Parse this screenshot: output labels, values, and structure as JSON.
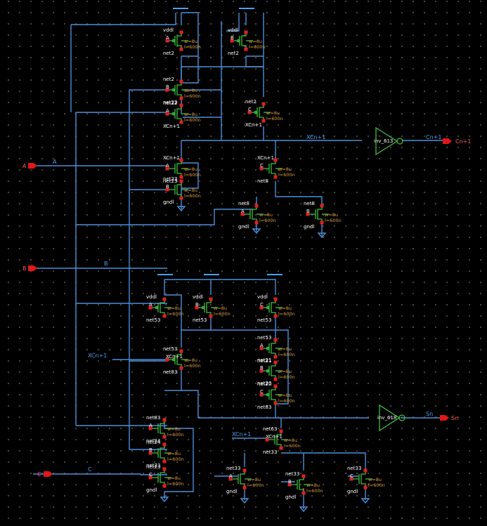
{
  "pins": {
    "A": "A",
    "B": "B",
    "C": "C",
    "Cn1": "Cn+1",
    "Sn": "Sn"
  },
  "nets": {
    "A": "A",
    "B": "B",
    "C": "C",
    "xcn1_top": "XCn+1",
    "xcn1_mid": "XCn+1",
    "xcn1_bot": "XCn+1",
    "cn1": "Cn+1",
    "sn": "Sn"
  },
  "inverters": {
    "carry": "inv_613",
    "sum": "inv_618"
  },
  "transistors": [
    {
      "id": "p1",
      "s": "vddl",
      "g": "A",
      "d": "net2",
      "w": "w=8u",
      "l": "l=600n"
    },
    {
      "id": "p2",
      "s": "vddl",
      "g": "B",
      "d": "net2",
      "w": "w=8u",
      "l": "l=600n"
    },
    {
      "id": "p3",
      "s": "net2",
      "g": "B",
      "d": "net22",
      "w": "w=8u",
      "l": "l=600n"
    },
    {
      "id": "p4",
      "s": "net22",
      "g": "A",
      "d": "XCn+1",
      "w": "w=8u",
      "l": "l=600n"
    },
    {
      "id": "p5",
      "s": "net2",
      "g": "C",
      "d": "XCn+1",
      "w": "w=8u",
      "l": "l=600n"
    },
    {
      "id": "n1",
      "s": "XCn+1",
      "g": "A",
      "d": "net23",
      "w": "w=8u",
      "l": "l=600n"
    },
    {
      "id": "n2",
      "s": "net23",
      "g": "B",
      "d": "gndl",
      "w": "w=8u",
      "l": "l=600n"
    },
    {
      "id": "n3",
      "s": "XCn+1",
      "g": "C",
      "d": "net8",
      "w": "w=8u",
      "l": "l=600n"
    },
    {
      "id": "n4",
      "s": "net8",
      "g": "A",
      "d": "gndl",
      "w": "w=8u",
      "l": "l=600n"
    },
    {
      "id": "n5",
      "s": "net8",
      "g": "B",
      "d": "gndl",
      "w": "w=8u",
      "l": "l=600n"
    },
    {
      "id": "p6",
      "s": "vddl",
      "g": "A",
      "d": "net53",
      "w": "w=8u",
      "l": "l=600n"
    },
    {
      "id": "p7",
      "s": "vddl",
      "g": "B",
      "d": "net53",
      "w": "w=8u",
      "l": "l=600n"
    },
    {
      "id": "p8",
      "s": "vddl",
      "g": "C",
      "d": "net53",
      "w": "w=8u",
      "l": "l=600n"
    },
    {
      "id": "p9",
      "s": "net53",
      "g": "XCn+1",
      "d": "net83",
      "w": "w=8u",
      "l": "l=600n"
    },
    {
      "id": "p10",
      "s": "net53",
      "g": "A",
      "d": "net21",
      "w": "w=8u",
      "l": "l=600n"
    },
    {
      "id": "p11",
      "s": "net21",
      "g": "B",
      "d": "net20",
      "w": "w=8u",
      "l": "l=600n"
    },
    {
      "id": "p12",
      "s": "net20",
      "g": "C",
      "d": "net83",
      "w": "w=8u",
      "l": "l=600n"
    },
    {
      "id": "n6",
      "s": "net83",
      "g": "A",
      "d": "net24",
      "w": "w=8u",
      "l": "l=600n"
    },
    {
      "id": "n7",
      "s": "net24",
      "g": "B",
      "d": "net23",
      "w": "w=8u",
      "l": "l=600n"
    },
    {
      "id": "n8",
      "s": "net23",
      "g": "C",
      "d": "gndl",
      "w": "w=8u",
      "l": "l=600n"
    },
    {
      "id": "n9",
      "s": "net63",
      "g": "XCn+1",
      "d": "net33",
      "w": "w=8u",
      "l": "l=600n"
    },
    {
      "id": "n10",
      "s": "net33",
      "g": "A",
      "d": "gndl",
      "w": "w=8u",
      "l": "l=600n"
    },
    {
      "id": "n11",
      "s": "net33",
      "g": "B",
      "d": "gndl",
      "w": "w=8u",
      "l": "l=600n"
    },
    {
      "id": "n12",
      "s": "net33",
      "g": "C",
      "d": "gndl",
      "w": "w=8u",
      "l": "l=600n"
    }
  ]
}
